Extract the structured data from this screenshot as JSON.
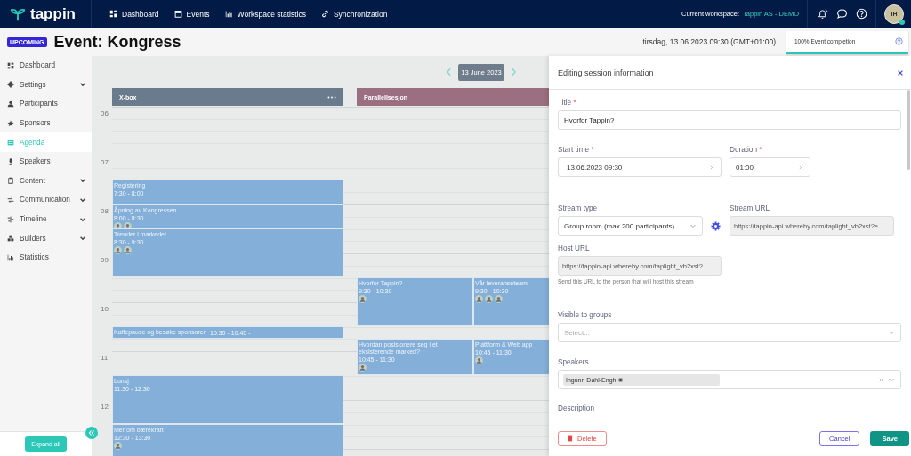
{
  "topbar": {
    "logo": "tappin",
    "nav": [
      {
        "label": "Dashboard"
      },
      {
        "label": "Events"
      },
      {
        "label": "Workspace statistics"
      },
      {
        "label": "Synchronization"
      }
    ],
    "workspace_label": "Current workspace:",
    "workspace": "Tappin AS - DEMO",
    "user_initials": "IH"
  },
  "header": {
    "status": "UPCOMING",
    "title": "Event: Kongress",
    "datetime": "tirsdag, 13.06.2023 09:30 (GMT+01:00)",
    "completion": {
      "label": "100% Event completion",
      "level": 1
    }
  },
  "sidebar": {
    "items": [
      {
        "label": "Dashboard",
        "kind": "link",
        "selected": false
      },
      {
        "label": "Settings",
        "kind": "group",
        "selected": false
      },
      {
        "label": "Participants",
        "kind": "link",
        "selected": false
      },
      {
        "label": "Sponsors",
        "kind": "link",
        "selected": false
      },
      {
        "label": "Agenda",
        "kind": "link",
        "selected": true
      },
      {
        "label": "Speakers",
        "kind": "link",
        "selected": false
      },
      {
        "label": "Content",
        "kind": "group",
        "selected": false
      },
      {
        "label": "Communication",
        "kind": "group",
        "selected": false
      },
      {
        "label": "Timeline",
        "kind": "group",
        "selected": false
      },
      {
        "label": "Builders",
        "kind": "group",
        "selected": false
      },
      {
        "label": "Statistics",
        "kind": "link",
        "selected": false
      }
    ],
    "expand_button": "Expand all"
  },
  "agenda": {
    "date": "13 June 2023",
    "hours": [
      "06",
      "07",
      "08",
      "09",
      "10",
      "11",
      "12"
    ],
    "columns": [
      {
        "title": "X-box",
        "color": "#6b7b8e",
        "tracks": [
          [
            {
              "title": "Registering",
              "time": "7:30 - 8:00"
            },
            {
              "title": "Åpning av Kongressen",
              "time": "8:00 - 8:30",
              "speakers": [
                {
                  "kind": "avatar"
                },
                {
                  "kind": "avatar"
                }
              ]
            },
            {
              "title": "Trender i markedet",
              "time": "8:30 - 9:30",
              "speakers": [
                {
                  "kind": "avatar"
                },
                {
                  "kind": "avatar"
                }
              ]
            },
            {
              "title": "Kaffepause og besøke sponsorer",
              "time": "10:30 - 10:45 -"
            },
            {
              "title": "Lunsj",
              "time": "11:30 - 12:30"
            },
            {
              "title": "Mer om bærekraft",
              "time": "12:30 - 13:30",
              "speakers": [
                {
                  "kind": "avatar"
                }
              ]
            }
          ]
        ]
      },
      {
        "title": "Parallellsesjon",
        "color": "#9b6f80",
        "tracks": [
          [
            {
              "title": "Hvorfor Tappin?",
              "time": "9:30 - 10:30",
              "speakers": [
                {
                  "kind": "avatar"
                }
              ]
            },
            {
              "title": "Hvordan posisjonere seg i et eksisterende marked?",
              "time": "10:45 - 11:30",
              "speakers": [
                {
                  "kind": "avatar"
                }
              ]
            }
          ],
          [
            {
              "title": "Vår leveranseteam",
              "time": "9:30 - 10:30",
              "speakers": [
                {
                  "kind": "avatar"
                },
                {
                  "kind": "avatar"
                },
                {
                  "kind": "avatar"
                }
              ]
            },
            {
              "title": "Plattform & Web app",
              "time": "10:45 - 11:30",
              "speakers": [
                {
                  "kind": "avatar"
                }
              ]
            }
          ]
        ]
      }
    ]
  },
  "session_panel": {
    "title": "Editing session information",
    "title_field": {
      "label": "Title",
      "required": "*",
      "value": "Hvorfor Tappin?"
    },
    "start_time": {
      "label": "Start time",
      "required": "*",
      "value": "13.06.2023 09:30"
    },
    "duration": {
      "label": "Duration",
      "required": "*",
      "value": "01:00"
    },
    "stream_type": {
      "label": "Stream type",
      "value": "Group room (max 200 participants)"
    },
    "stream_url": {
      "label": "Stream URL",
      "value": "https://tappin-api.whereby.com/taplight_vb2xst?e",
      "disabled": true
    },
    "host_url": {
      "label": "Host URL",
      "value": "https://tappin-api.whereby.com/taplight_vb2xst?",
      "disabled": true,
      "help": "Send this URL to the person that will host this stream"
    },
    "visible_groups": {
      "label": "Visible to groups",
      "placeholder": "Select..."
    },
    "speakers": {
      "label": "Speakers",
      "tags": [
        "Ingunn Dahl-Engh"
      ]
    },
    "description": {
      "label": "Description"
    },
    "buttons": {
      "delete": "Delete",
      "cancel": "Cancel",
      "save": "Save"
    }
  }
}
